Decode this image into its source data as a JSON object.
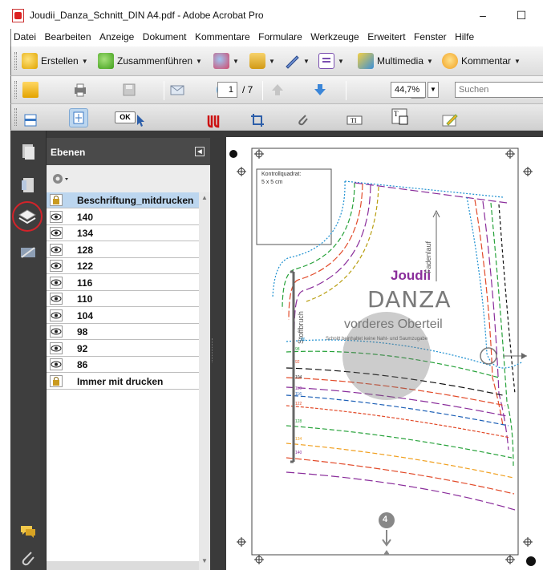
{
  "window": {
    "title": "Joudii_Danza_Schnitt_DIN A4.pdf - Adobe Acrobat Pro",
    "minimize_label": "–",
    "maximize_label": "☐"
  },
  "menu": [
    "Datei",
    "Bearbeiten",
    "Anzeige",
    "Dokument",
    "Kommentare",
    "Formulare",
    "Werkzeuge",
    "Erweitert",
    "Fenster",
    "Hilfe"
  ],
  "toolbar1": {
    "create": "Erstellen",
    "combine": "Zusammenführen",
    "multimedia": "Multimedia",
    "comment": "Kommentar"
  },
  "toolbar2": {
    "page_current": "1",
    "page_total": "/ 7",
    "zoom": "44,7%",
    "search_placeholder": "Suchen"
  },
  "toolbar3": {
    "ok_label": "OK"
  },
  "panel": {
    "title": "Ebenen",
    "layers": [
      {
        "name": "Beschriftung_mitdrucken",
        "locked": true,
        "selected": true
      },
      {
        "name": "140",
        "locked": false
      },
      {
        "name": "134",
        "locked": false
      },
      {
        "name": "128",
        "locked": false
      },
      {
        "name": "122",
        "locked": false
      },
      {
        "name": "116",
        "locked": false
      },
      {
        "name": "110",
        "locked": false
      },
      {
        "name": "104",
        "locked": false
      },
      {
        "name": "98",
        "locked": false
      },
      {
        "name": "92",
        "locked": false
      },
      {
        "name": "86",
        "locked": false
      },
      {
        "name": "Immer mit drucken",
        "locked": true
      }
    ]
  },
  "document": {
    "control_square_title": "Kontrollquadrat:",
    "control_square_size": "5 x 5 cm",
    "brand": "Joudii",
    "product": "DANZA",
    "piece": "vorderes Oberteil",
    "note": "Schnitt beinhaltet keine Naht- und Saumzugabe",
    "grainline": "Fadenlauf",
    "fold": "Stoffbruch",
    "page_marker": "4",
    "size_labels": [
      "86",
      "98",
      "92",
      "104",
      "110",
      "116",
      "122",
      "128",
      "134",
      "140"
    ]
  },
  "colors": {
    "accent_circle": "#d2232a",
    "selected_row": "#bcd6ef",
    "dark_ui": "#3a3a3a",
    "brand_purple": "#8a2d9b"
  }
}
